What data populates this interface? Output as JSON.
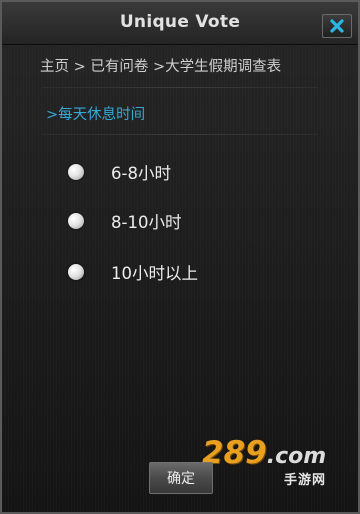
{
  "window": {
    "title": "Unique Vote",
    "close_icon": "close-icon"
  },
  "breadcrumb": "主页 > 已有问卷 >大学生假期调查表",
  "question": ">每天休息时间",
  "options": [
    {
      "label": "6-8小时",
      "icon": "radio-unselected-icon"
    },
    {
      "label": "8-10小时",
      "icon": "radio-unselected-icon"
    },
    {
      "label": "10小时以上",
      "icon": "radio-unselected-icon"
    }
  ],
  "confirm_label": "确定",
  "watermark": {
    "number": "289",
    "domain": ".com",
    "subtitle": "手游网"
  },
  "colors": {
    "accent": "#35a8d4",
    "background": "#1e1e1e",
    "text": "#e0e0e0",
    "close_x": "#29b7e6",
    "watermark_orange": "#e8a020"
  }
}
